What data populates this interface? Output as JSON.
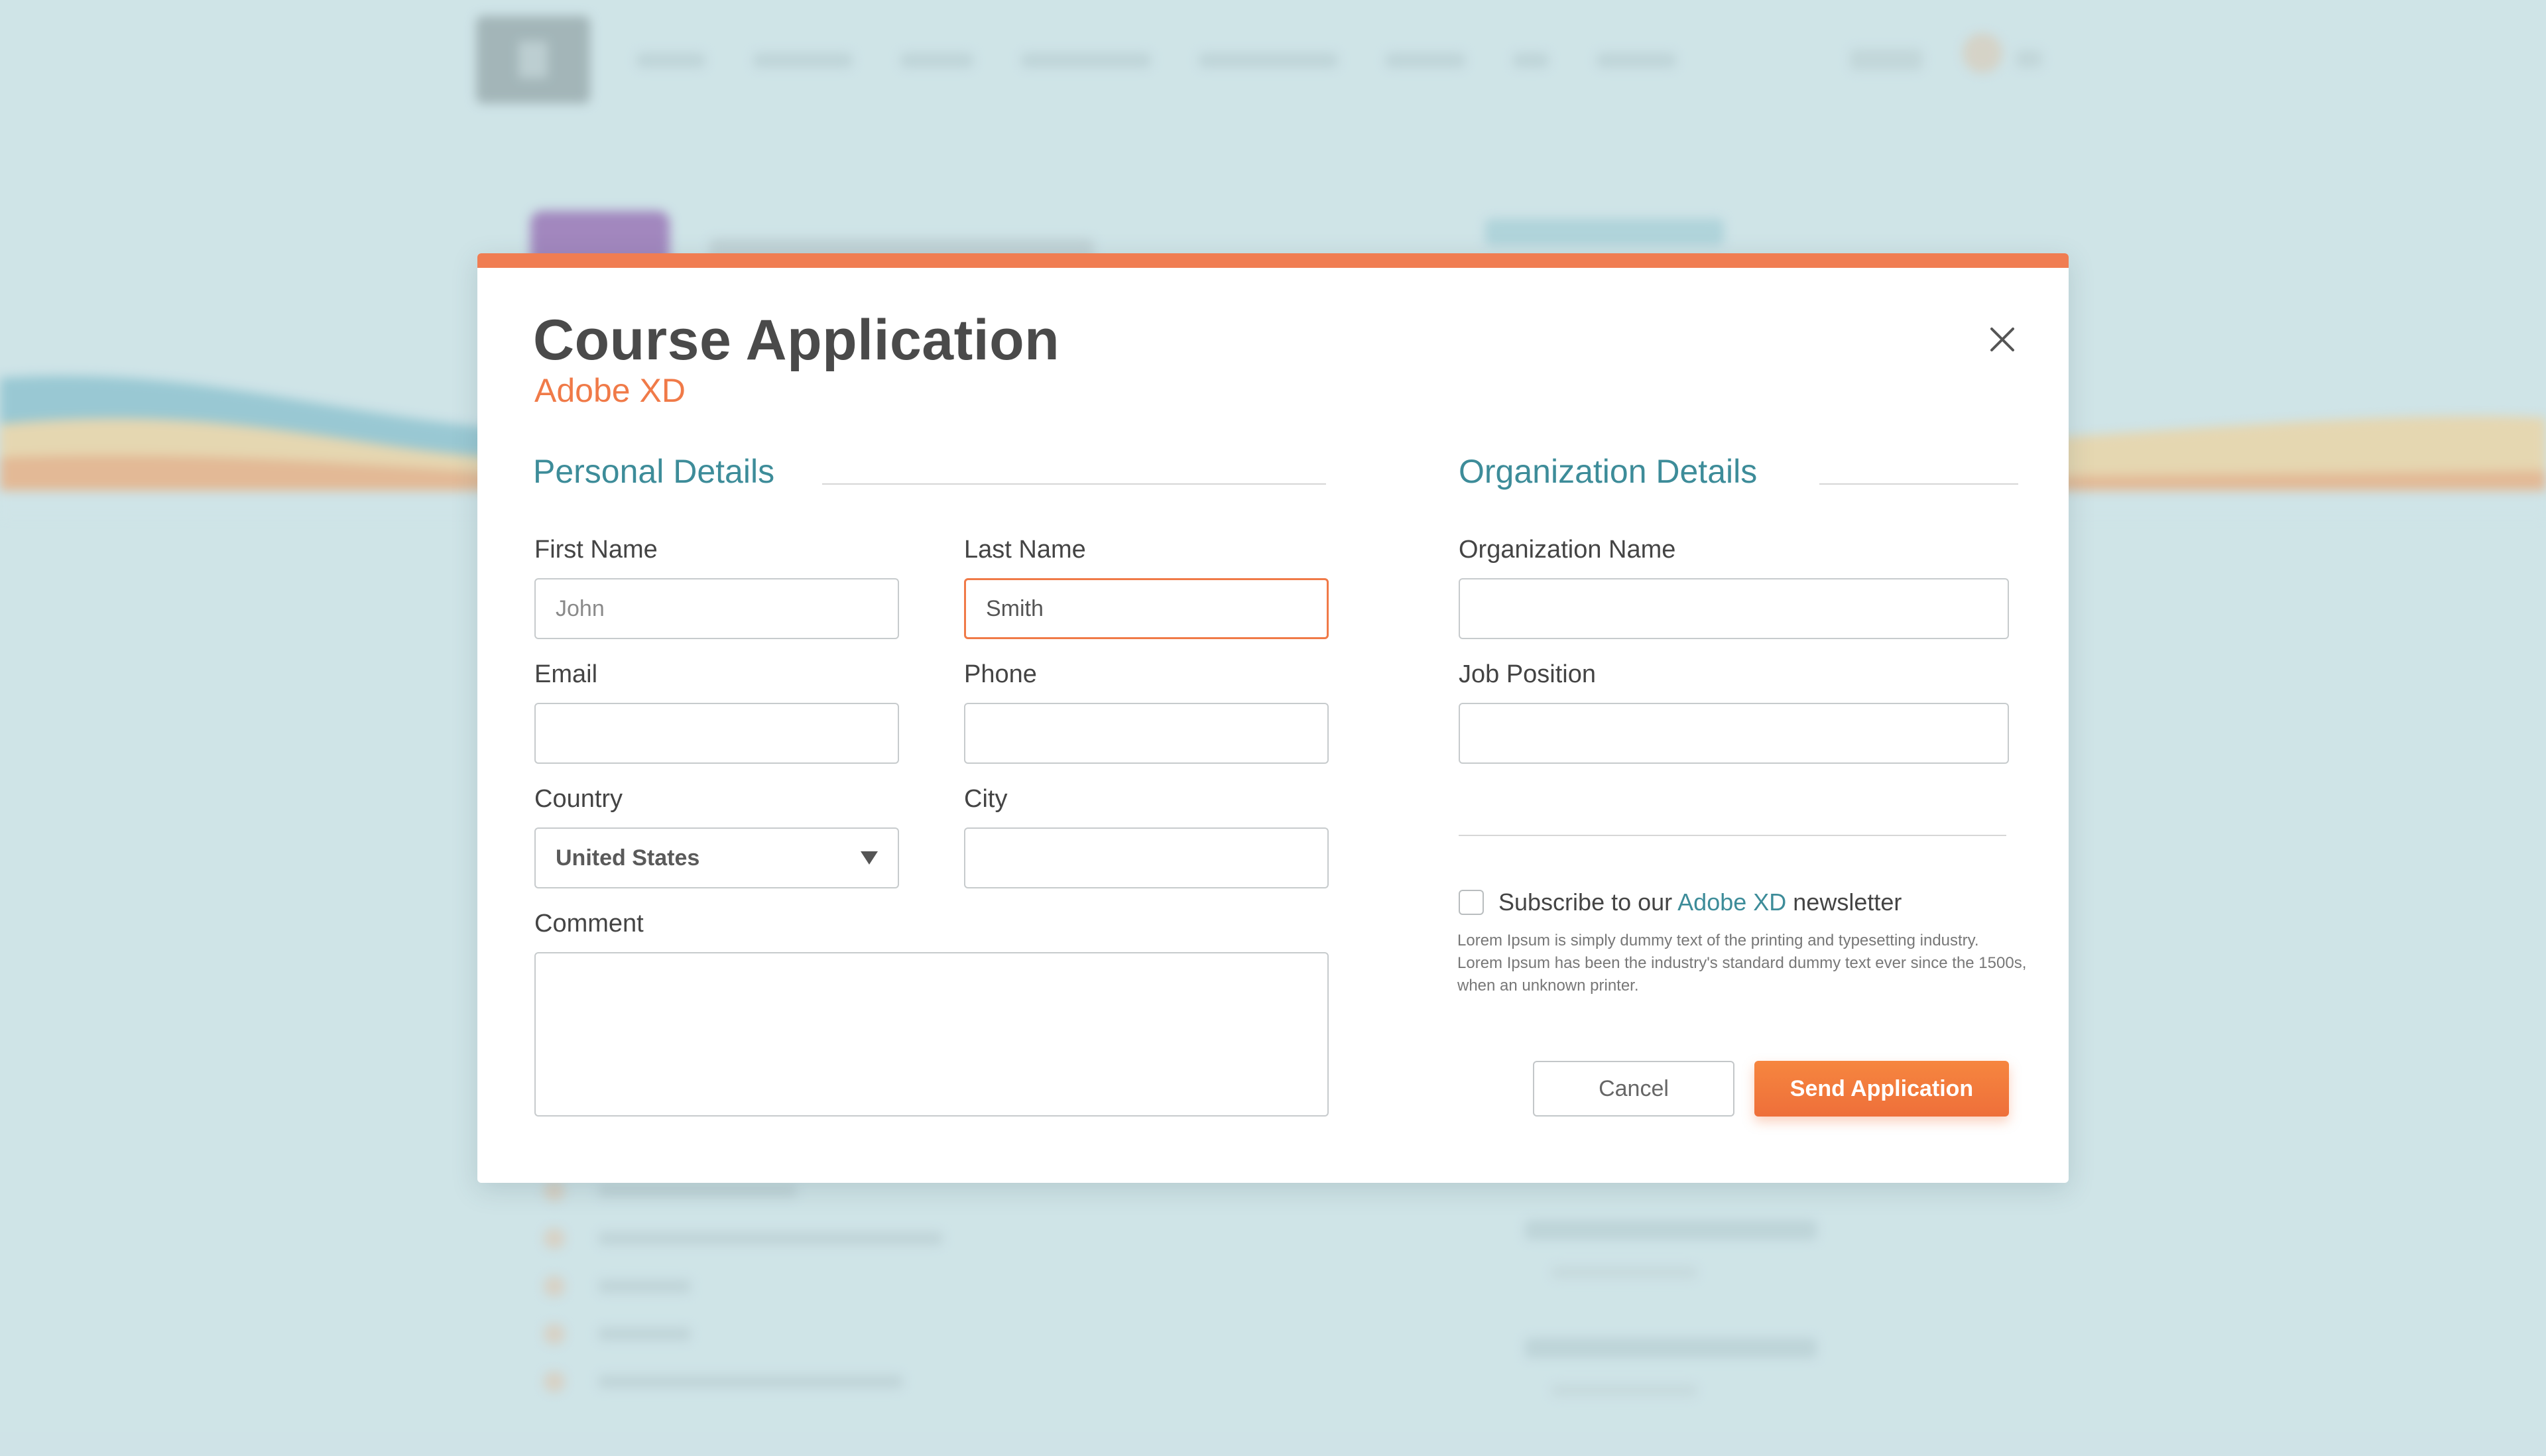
{
  "modal": {
    "title": "Course Application",
    "subtitle": "Adobe XD",
    "close_icon": "close-icon",
    "accent_color": "#f07a48",
    "section_color": "#3d8c99"
  },
  "personal": {
    "heading": "Personal Details",
    "first_name": {
      "label": "First Name",
      "placeholder": "John"
    },
    "last_name": {
      "label": "Last Name",
      "value": "Smith"
    },
    "email": {
      "label": "Email",
      "value": ""
    },
    "phone": {
      "label": "Phone",
      "value": ""
    },
    "country": {
      "label": "Country",
      "selected": "United States"
    },
    "city": {
      "label": "City",
      "value": ""
    },
    "comment": {
      "label": "Comment",
      "value": ""
    }
  },
  "organization": {
    "heading": "Organization Details",
    "org_name": {
      "label": "Organization Name",
      "value": ""
    },
    "job_position": {
      "label": "Job Position",
      "value": ""
    }
  },
  "newsletter": {
    "prefix": "Subscribe to our ",
    "link": "Adobe XD",
    "suffix": " newsletter",
    "checked": false,
    "fineprint": "Lorem Ipsum is simply dummy text of the printing and typesetting industry. Lorem Ipsum has been the industry's standard dummy text ever since the 1500s, when an unknown printer."
  },
  "actions": {
    "cancel": "Cancel",
    "send": "Send Application"
  }
}
